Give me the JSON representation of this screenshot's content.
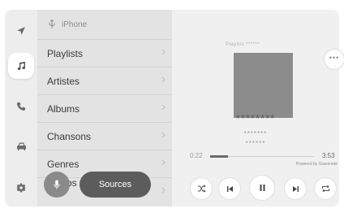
{
  "source": {
    "label": "iPhone"
  },
  "nav_rail": {
    "items": [
      {
        "icon": "navigation-arrow-icon"
      },
      {
        "icon": "music-note-icon",
        "active": true
      },
      {
        "icon": "phone-icon"
      },
      {
        "icon": "car-icon"
      },
      {
        "icon": "gear-icon"
      }
    ]
  },
  "browse_list": {
    "items": [
      {
        "label": "Playlists"
      },
      {
        "label": "Artistes"
      },
      {
        "label": "Albums"
      },
      {
        "label": "Chansons"
      },
      {
        "label": "Genres"
      }
    ],
    "occluded_label": "os"
  },
  "buttons": {
    "sources_label": "Sources"
  },
  "now_playing": {
    "playlist_label": "Playlist ******",
    "title": "********",
    "artist": "*******",
    "album": "******",
    "elapsed": "0:22",
    "remaining": "3:53",
    "progress": 0.17,
    "powered_by": "Powered by Gracenote"
  },
  "colors": {
    "rail_bg": "#ededed",
    "list_bg": "#e3e3e3",
    "player_bg": "#f0f0f0",
    "artwork": "#8c8c8c",
    "sources_button": "#5c5c5c",
    "mic_button": "#8a8a8a"
  }
}
